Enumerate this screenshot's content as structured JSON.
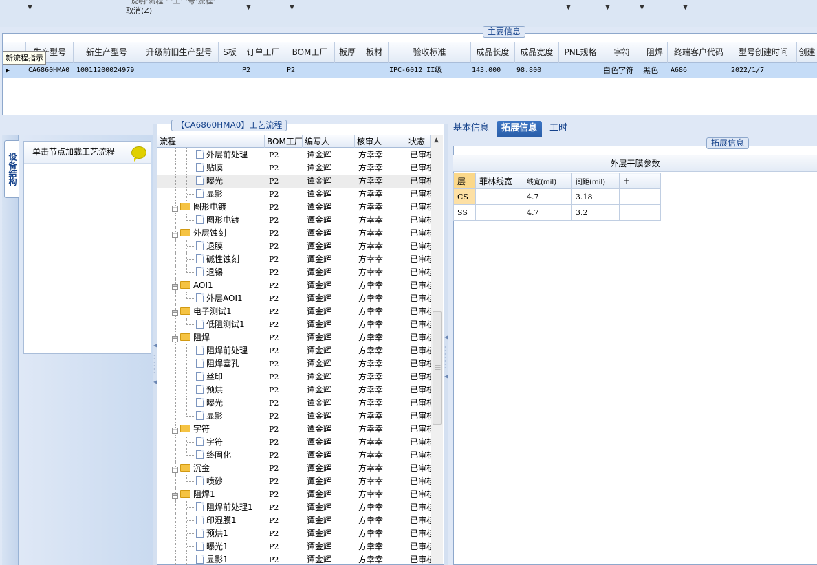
{
  "toolbar": {
    "cut_text": "说明·流程 ·  ·工·  ·号·流程·",
    "cancel": "取消(Z)"
  },
  "main_info": {
    "title": "主要信息",
    "tooltip": "新流程指示",
    "columns": [
      "生产型号",
      "新生产型号",
      "升级前旧生产型号",
      "S板",
      "订单工厂",
      "BOM工厂",
      "板厚",
      "板材",
      "验收标准",
      "成品长度",
      "成品宽度",
      "PNL规格",
      "字符",
      "阻焊",
      "终端客户代码",
      "型号创建时间",
      "创建"
    ],
    "row": {
      "prod_model": "CA6860HMA0",
      "new_model": "10011200024979",
      "old_model": "",
      "s_board": "",
      "order_factory": "P2",
      "bom_factory": "P2",
      "thickness": "",
      "material": "",
      "standard": "IPC-6012 II级",
      "length": "143.000",
      "width": "98.800",
      "pnl": "",
      "char": "白色字符",
      "solder": "黑色",
      "customer": "A686",
      "created": "2022/1/7"
    }
  },
  "left": {
    "vtab": "设备结构",
    "load_hint": "单击节点加载工艺流程"
  },
  "tree": {
    "title": "【CA6860HMA0】工艺流程",
    "columns": [
      "流程",
      "BOM工厂",
      "编写人",
      "核审人",
      "状态"
    ],
    "rows": [
      {
        "type": "leaf",
        "name": "外层前处理",
        "bom": "P2",
        "writer": "谭金辉",
        "reviewer": "方幸幸",
        "status": "已审核"
      },
      {
        "type": "leaf",
        "name": "贴膜",
        "bom": "P2",
        "writer": "谭金辉",
        "reviewer": "方幸幸",
        "status": "已审核"
      },
      {
        "type": "leaf",
        "name": "曝光",
        "bom": "P2",
        "writer": "谭金辉",
        "reviewer": "方幸幸",
        "status": "已审核",
        "selected": true
      },
      {
        "type": "leaf",
        "name": "显影",
        "bom": "P2",
        "writer": "谭金辉",
        "reviewer": "方幸幸",
        "status": "已审核"
      },
      {
        "type": "folder",
        "name": "图形电镀",
        "bom": "P2",
        "writer": "谭金辉",
        "reviewer": "方幸幸",
        "status": "已审核"
      },
      {
        "type": "leaf",
        "name": "图形电镀",
        "bom": "P2",
        "writer": "谭金辉",
        "reviewer": "方幸幸",
        "status": "已审核",
        "last": true
      },
      {
        "type": "folder",
        "name": "外层蚀刻",
        "bom": "P2",
        "writer": "谭金辉",
        "reviewer": "方幸幸",
        "status": "已审核"
      },
      {
        "type": "leaf",
        "name": "退膜",
        "bom": "P2",
        "writer": "谭金辉",
        "reviewer": "方幸幸",
        "status": "已审核"
      },
      {
        "type": "leaf",
        "name": "碱性蚀刻",
        "bom": "P2",
        "writer": "谭金辉",
        "reviewer": "方幸幸",
        "status": "已审核"
      },
      {
        "type": "leaf",
        "name": "退锡",
        "bom": "P2",
        "writer": "谭金辉",
        "reviewer": "方幸幸",
        "status": "已审核",
        "last": true
      },
      {
        "type": "folder",
        "name": "AOI1",
        "bom": "P2",
        "writer": "谭金辉",
        "reviewer": "方幸幸",
        "status": "已审核"
      },
      {
        "type": "leaf",
        "name": "外层AOI1",
        "bom": "P2",
        "writer": "谭金辉",
        "reviewer": "方幸幸",
        "status": "已审核",
        "last": true
      },
      {
        "type": "folder",
        "name": "电子测试1",
        "bom": "P2",
        "writer": "谭金辉",
        "reviewer": "方幸幸",
        "status": "已审核"
      },
      {
        "type": "leaf",
        "name": "低阻测试1",
        "bom": "P2",
        "writer": "谭金辉",
        "reviewer": "方幸幸",
        "status": "已审核",
        "last": true
      },
      {
        "type": "folder",
        "name": "阻焊",
        "bom": "P2",
        "writer": "谭金辉",
        "reviewer": "方幸幸",
        "status": "已审核"
      },
      {
        "type": "leaf",
        "name": "阻焊前处理",
        "bom": "P2",
        "writer": "谭金辉",
        "reviewer": "方幸幸",
        "status": "已审核"
      },
      {
        "type": "leaf",
        "name": "阻焊塞孔",
        "bom": "P2",
        "writer": "谭金辉",
        "reviewer": "方幸幸",
        "status": "已审核"
      },
      {
        "type": "leaf",
        "name": "丝印",
        "bom": "P2",
        "writer": "谭金辉",
        "reviewer": "方幸幸",
        "status": "已审核"
      },
      {
        "type": "leaf",
        "name": "预烘",
        "bom": "P2",
        "writer": "谭金辉",
        "reviewer": "方幸幸",
        "status": "已审核"
      },
      {
        "type": "leaf",
        "name": "曝光",
        "bom": "P2",
        "writer": "谭金辉",
        "reviewer": "方幸幸",
        "status": "已审核"
      },
      {
        "type": "leaf",
        "name": "显影",
        "bom": "P2",
        "writer": "谭金辉",
        "reviewer": "方幸幸",
        "status": "已审核",
        "last": true
      },
      {
        "type": "folder",
        "name": "字符",
        "bom": "P2",
        "writer": "谭金辉",
        "reviewer": "方幸幸",
        "status": "已审核"
      },
      {
        "type": "leaf",
        "name": "字符",
        "bom": "P2",
        "writer": "谭金辉",
        "reviewer": "方幸幸",
        "status": "已审核"
      },
      {
        "type": "leaf",
        "name": "终固化",
        "bom": "P2",
        "writer": "谭金辉",
        "reviewer": "方幸幸",
        "status": "已审核",
        "last": true
      },
      {
        "type": "folder",
        "name": "沉金",
        "bom": "P2",
        "writer": "谭金辉",
        "reviewer": "方幸幸",
        "status": "已审核"
      },
      {
        "type": "leaf",
        "name": "喷砂",
        "bom": "P2",
        "writer": "谭金辉",
        "reviewer": "方幸幸",
        "status": "已审核",
        "last": true
      },
      {
        "type": "folder",
        "name": "阻焊1",
        "bom": "P2",
        "writer": "谭金辉",
        "reviewer": "方幸幸",
        "status": "已审核"
      },
      {
        "type": "leaf",
        "name": "阻焊前处理1",
        "bom": "P2",
        "writer": "谭金辉",
        "reviewer": "方幸幸",
        "status": "已审核"
      },
      {
        "type": "leaf",
        "name": "印湿膜1",
        "bom": "P2",
        "writer": "谭金辉",
        "reviewer": "方幸幸",
        "status": "已审核"
      },
      {
        "type": "leaf",
        "name": "预烘1",
        "bom": "P2",
        "writer": "谭金辉",
        "reviewer": "方幸幸",
        "status": "已审核"
      },
      {
        "type": "leaf",
        "name": "曝光1",
        "bom": "P2",
        "writer": "谭金辉",
        "reviewer": "方幸幸",
        "status": "已审核"
      },
      {
        "type": "leaf",
        "name": "显影1",
        "bom": "P2",
        "writer": "谭金辉",
        "reviewer": "方幸幸",
        "status": "已审核"
      }
    ]
  },
  "right": {
    "tabs": [
      "基本信息",
      "拓展信息",
      "工时"
    ],
    "active_tab": "拓展信息",
    "group_title": "拓展信息",
    "table_title": "外层干膜参数",
    "headers": [
      "层",
      "菲林线宽",
      "线宽(mil)",
      "间距(mil)",
      "+",
      "-"
    ],
    "rows": [
      {
        "layer": "CS",
        "film": "",
        "line": "4.7",
        "space": "3.18"
      },
      {
        "layer": "SS",
        "film": "",
        "line": "4.7",
        "space": "3.2"
      }
    ]
  }
}
